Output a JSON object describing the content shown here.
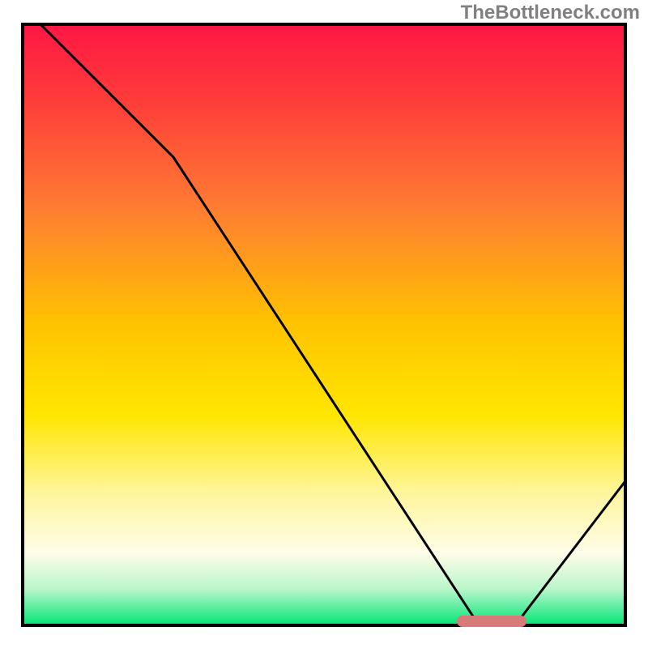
{
  "watermark": "TheBottleneck.com",
  "chart_data": {
    "type": "line",
    "title": "",
    "xlabel": "",
    "ylabel": "",
    "xlim": [
      0,
      100
    ],
    "ylim": [
      0,
      100
    ],
    "x": [
      3,
      25,
      75,
      82,
      100
    ],
    "values": [
      100,
      78,
      1,
      1,
      24
    ],
    "optimal_marker": {
      "x_start": 72,
      "x_end": 83,
      "y": 0.5,
      "color": "#d97a7a"
    },
    "background_gradient": {
      "stops": [
        {
          "offset": 0.0,
          "color": "#ff1744"
        },
        {
          "offset": 0.12,
          "color": "#ff3a3a"
        },
        {
          "offset": 0.3,
          "color": "#ff7a33"
        },
        {
          "offset": 0.5,
          "color": "#ffc300"
        },
        {
          "offset": 0.65,
          "color": "#ffe600"
        },
        {
          "offset": 0.78,
          "color": "#fff59d"
        },
        {
          "offset": 0.88,
          "color": "#fffde7"
        },
        {
          "offset": 0.94,
          "color": "#b9f6ca"
        },
        {
          "offset": 1.0,
          "color": "#00e676"
        }
      ]
    },
    "curve_color": "#000000",
    "curve_width": 3,
    "border_color": "#000000",
    "border_width": 4
  }
}
